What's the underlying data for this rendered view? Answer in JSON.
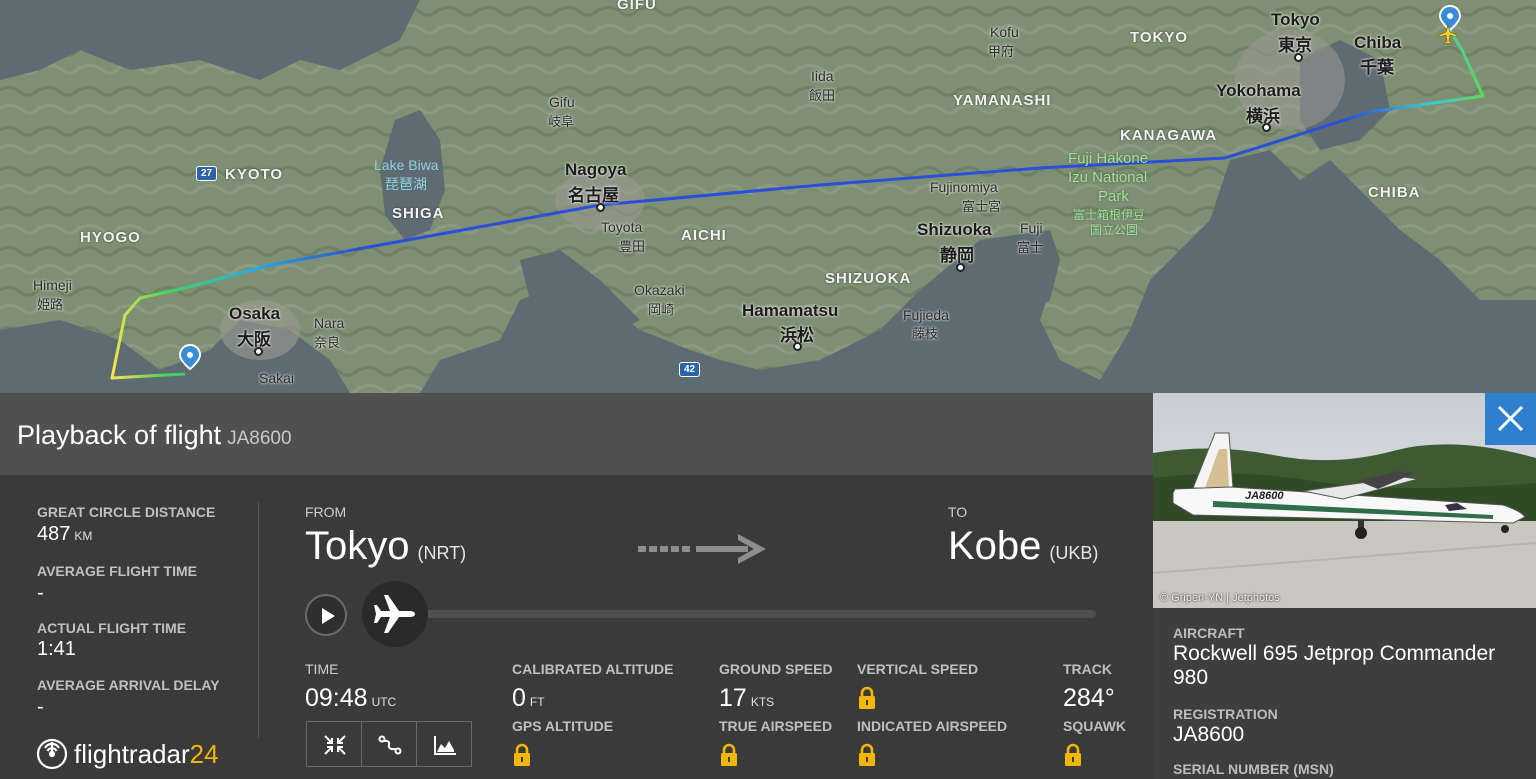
{
  "map": {
    "labels": {
      "gifu_top": "GIFU",
      "tokyo": "Tokyo",
      "tokyo_kanji": "東京",
      "chiba_city": "Chiba",
      "chiba_kanji": "千葉",
      "yokohama": "Yokohama",
      "yokohama_kanji": "横浜",
      "kofu": "Kofu",
      "kofu_kanji": "甲府",
      "iida": "Iida",
      "iida_kanji": "飯田",
      "gifu": "Gifu",
      "gifu_kanji": "岐阜",
      "nagoya": "Nagoya",
      "nagoya_kanji": "名古屋",
      "toyota": "Toyota",
      "toyota_kanji": "豊田",
      "okazaki": "Okazaki",
      "okazaki_kanji": "岡崎",
      "hamamatsu": "Hamamatsu",
      "hamamatsu_kanji": "浜松",
      "shizuoka": "Shizuoka",
      "shizuoka_kanji": "静岡",
      "fujinomiya": "Fujinomiya",
      "fujinomiya_kanji": "富士宮",
      "fuji": "Fuji",
      "fuji_kanji": "富士",
      "fujieda": "Fujieda",
      "fujieda_kanji": "藤枝",
      "osaka": "Osaka",
      "osaka_kanji": "大阪",
      "nara": "Nara",
      "nara_kanji": "奈良",
      "sakai": "Sakai",
      "himeji": "Himeji",
      "himeji_kanji": "姫路",
      "lake_biwa": "Lake Biwa",
      "lake_biwa_kanji": "琵琶湖",
      "park1": "Fuji Hakone",
      "park2": "Izu National",
      "park3": "Park",
      "park_kanji1": "富士箱根伊豆",
      "park_kanji2": "国立公園",
      "pref_tokyo": "TOKYO",
      "pref_yamanashi": "YAMANASHI",
      "pref_kanagawa": "KANAGAWA",
      "pref_chiba": "CHIBA",
      "pref_kyoto": "KYOTO",
      "pref_hyogo": "HYOGO",
      "pref_shiga": "SHIGA",
      "pref_aichi": "AICHI",
      "pref_shizuoka": "SHIZUOKA",
      "road_27": "27",
      "road_42": "42"
    }
  },
  "panel": {
    "title": "Playback of flight",
    "registration": "JA8600",
    "stats": {
      "great_circle_label": "GREAT CIRCLE DISTANCE",
      "great_circle_value": "487",
      "great_circle_unit": "KM",
      "avg_flight_label": "AVERAGE FLIGHT TIME",
      "avg_flight_value": "-",
      "actual_flight_label": "ACTUAL FLIGHT TIME",
      "actual_flight_value": "1:41",
      "avg_delay_label": "AVERAGE ARRIVAL DELAY",
      "avg_delay_value": "-"
    },
    "route": {
      "from_label": "FROM",
      "from_city": "Tokyo",
      "from_code": "(NRT)",
      "to_label": "TO",
      "to_city": "Kobe",
      "to_code": "(UKB)"
    },
    "playback": {
      "progress": 0
    },
    "telemetry": {
      "time_label": "TIME",
      "time_value": "09:48",
      "time_unit": "UTC",
      "cal_alt_label": "CALIBRATED ALTITUDE",
      "cal_alt_value": "0",
      "cal_alt_unit": "FT",
      "gps_alt_label": "GPS ALTITUDE",
      "ground_speed_label": "GROUND SPEED",
      "ground_speed_value": "17",
      "ground_speed_unit": "KTS",
      "true_airspeed_label": "TRUE AIRSPEED",
      "vertical_speed_label": "VERTICAL SPEED",
      "indicated_airspeed_label": "INDICATED AIRSPEED",
      "track_label": "TRACK",
      "track_value": "284°",
      "squawk_label": "SQUAWK"
    },
    "tools": [
      "fit-icon",
      "route-icon",
      "chart-icon"
    ],
    "logo": {
      "brand_a": "flightradar",
      "brand_b": "24"
    }
  },
  "aircraft": {
    "photo_credit": "© Gripen-YN | Jetphotos",
    "photo_registration": "JA8600",
    "aircraft_label": "AIRCRAFT",
    "aircraft_value": "Rockwell 695 Jetprop Commander 980",
    "registration_label": "REGISTRATION",
    "registration_value": "JA8600",
    "serial_label": "SERIAL NUMBER (MSN)"
  },
  "colors": {
    "accent_blue": "#2f7fcf",
    "lock_yellow": "#f2b705",
    "panel_dark": "#3a3a3a",
    "panel_head": "#505050"
  }
}
